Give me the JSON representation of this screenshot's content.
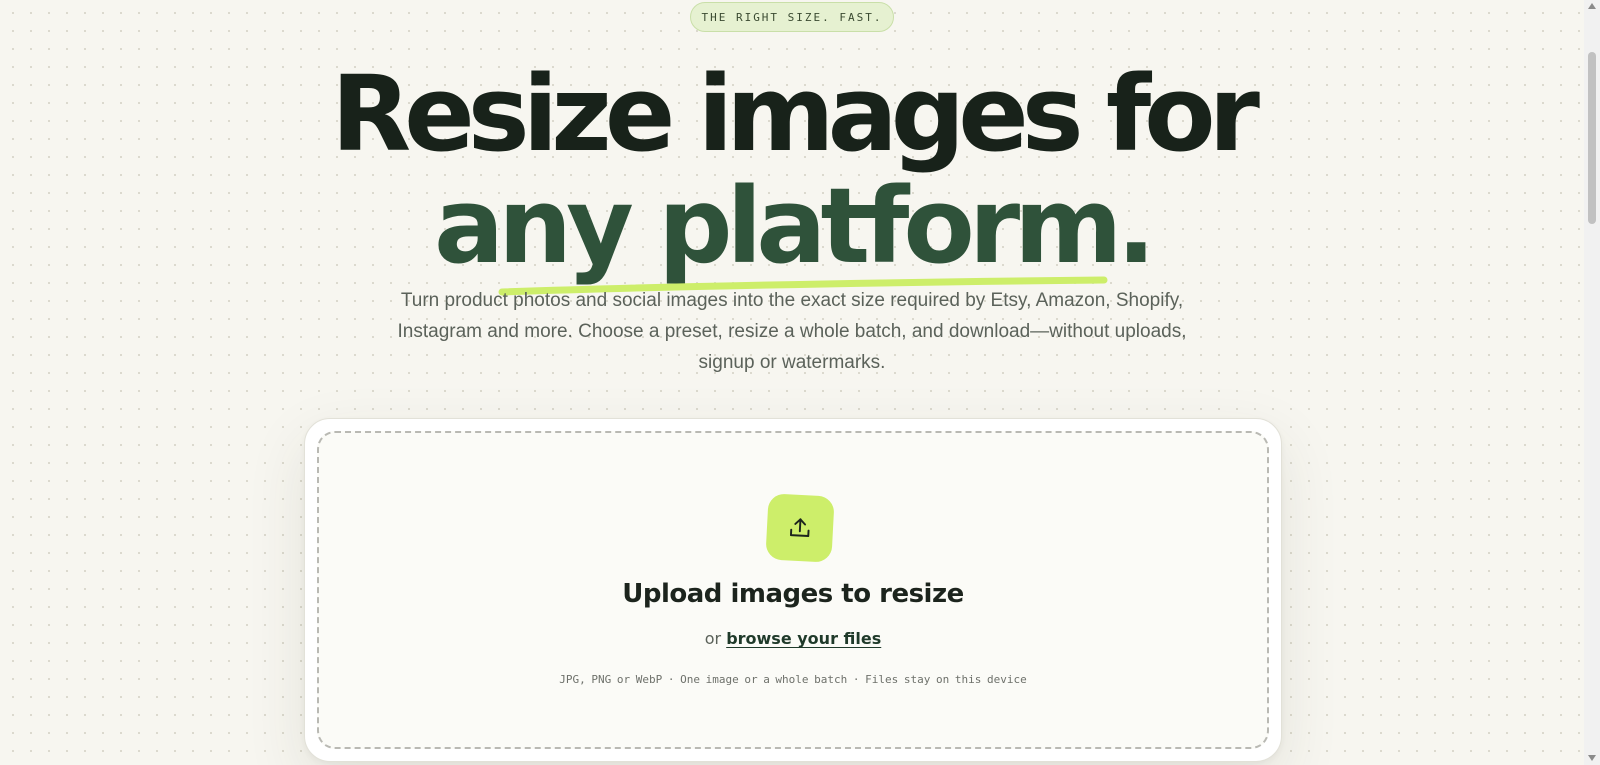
{
  "badge": {
    "text": "THE RIGHT SIZE. FAST."
  },
  "hero": {
    "line1": "Resize images for",
    "line2": "any platform.",
    "subtitle": "Turn product photos and social images into the exact size required by Etsy, Amazon, Shopify, Instagram and more. Choose a preset, resize a whole batch, and download—without uploads, signup or watermarks."
  },
  "upload": {
    "icon": "upload-icon",
    "title": "Upload images to resize",
    "or_text": "or ",
    "browse_label": "browse your files",
    "hint": "JPG, PNG or WebP · One image or a whole batch · Files stay on this device"
  },
  "colors": {
    "accent": "#cdee6a",
    "heading_dark": "#18221a",
    "heading_green": "#2f523a",
    "badge_bg": "#e6f1d1"
  }
}
